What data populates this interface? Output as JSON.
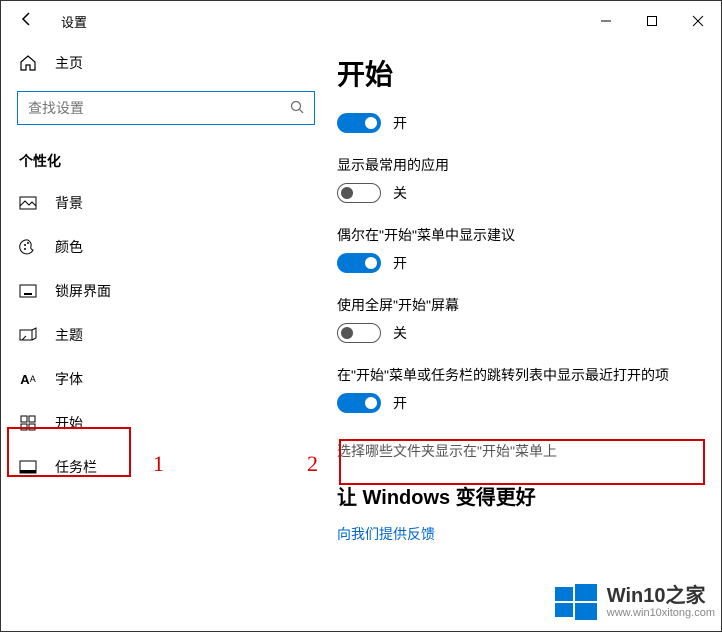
{
  "titlebar": {
    "app_title": "设置"
  },
  "sidebar": {
    "home_label": "主页",
    "search_placeholder": "查找设置",
    "category_label": "个性化",
    "items": [
      {
        "label": "背景"
      },
      {
        "label": "颜色"
      },
      {
        "label": "锁屏界面"
      },
      {
        "label": "主题"
      },
      {
        "label": "字体"
      },
      {
        "label": "开始"
      },
      {
        "label": "任务栏"
      }
    ]
  },
  "content": {
    "page_title": "开始",
    "settings": [
      {
        "label": "",
        "toggle": "on",
        "toggle_text": "开"
      },
      {
        "label": "显示最常用的应用",
        "toggle": "off",
        "toggle_text": "关"
      },
      {
        "label": "偶尔在\"开始\"菜单中显示建议",
        "toggle": "on",
        "toggle_text": "开"
      },
      {
        "label": "使用全屏\"开始\"屏幕",
        "toggle": "off",
        "toggle_text": "关"
      },
      {
        "label": "在\"开始\"菜单或任务栏的跳转列表中显示最近打开的项",
        "toggle": "on",
        "toggle_text": "开"
      }
    ],
    "folder_link": "选择哪些文件夹显示在\"开始\"菜单上",
    "better_heading": "让 Windows 变得更好",
    "feedback_link": "向我们提供反馈"
  },
  "annotations": {
    "n1": "1",
    "n2": "2"
  },
  "watermark": {
    "title": "Win10之家",
    "url": "www.win10xitong.com"
  }
}
